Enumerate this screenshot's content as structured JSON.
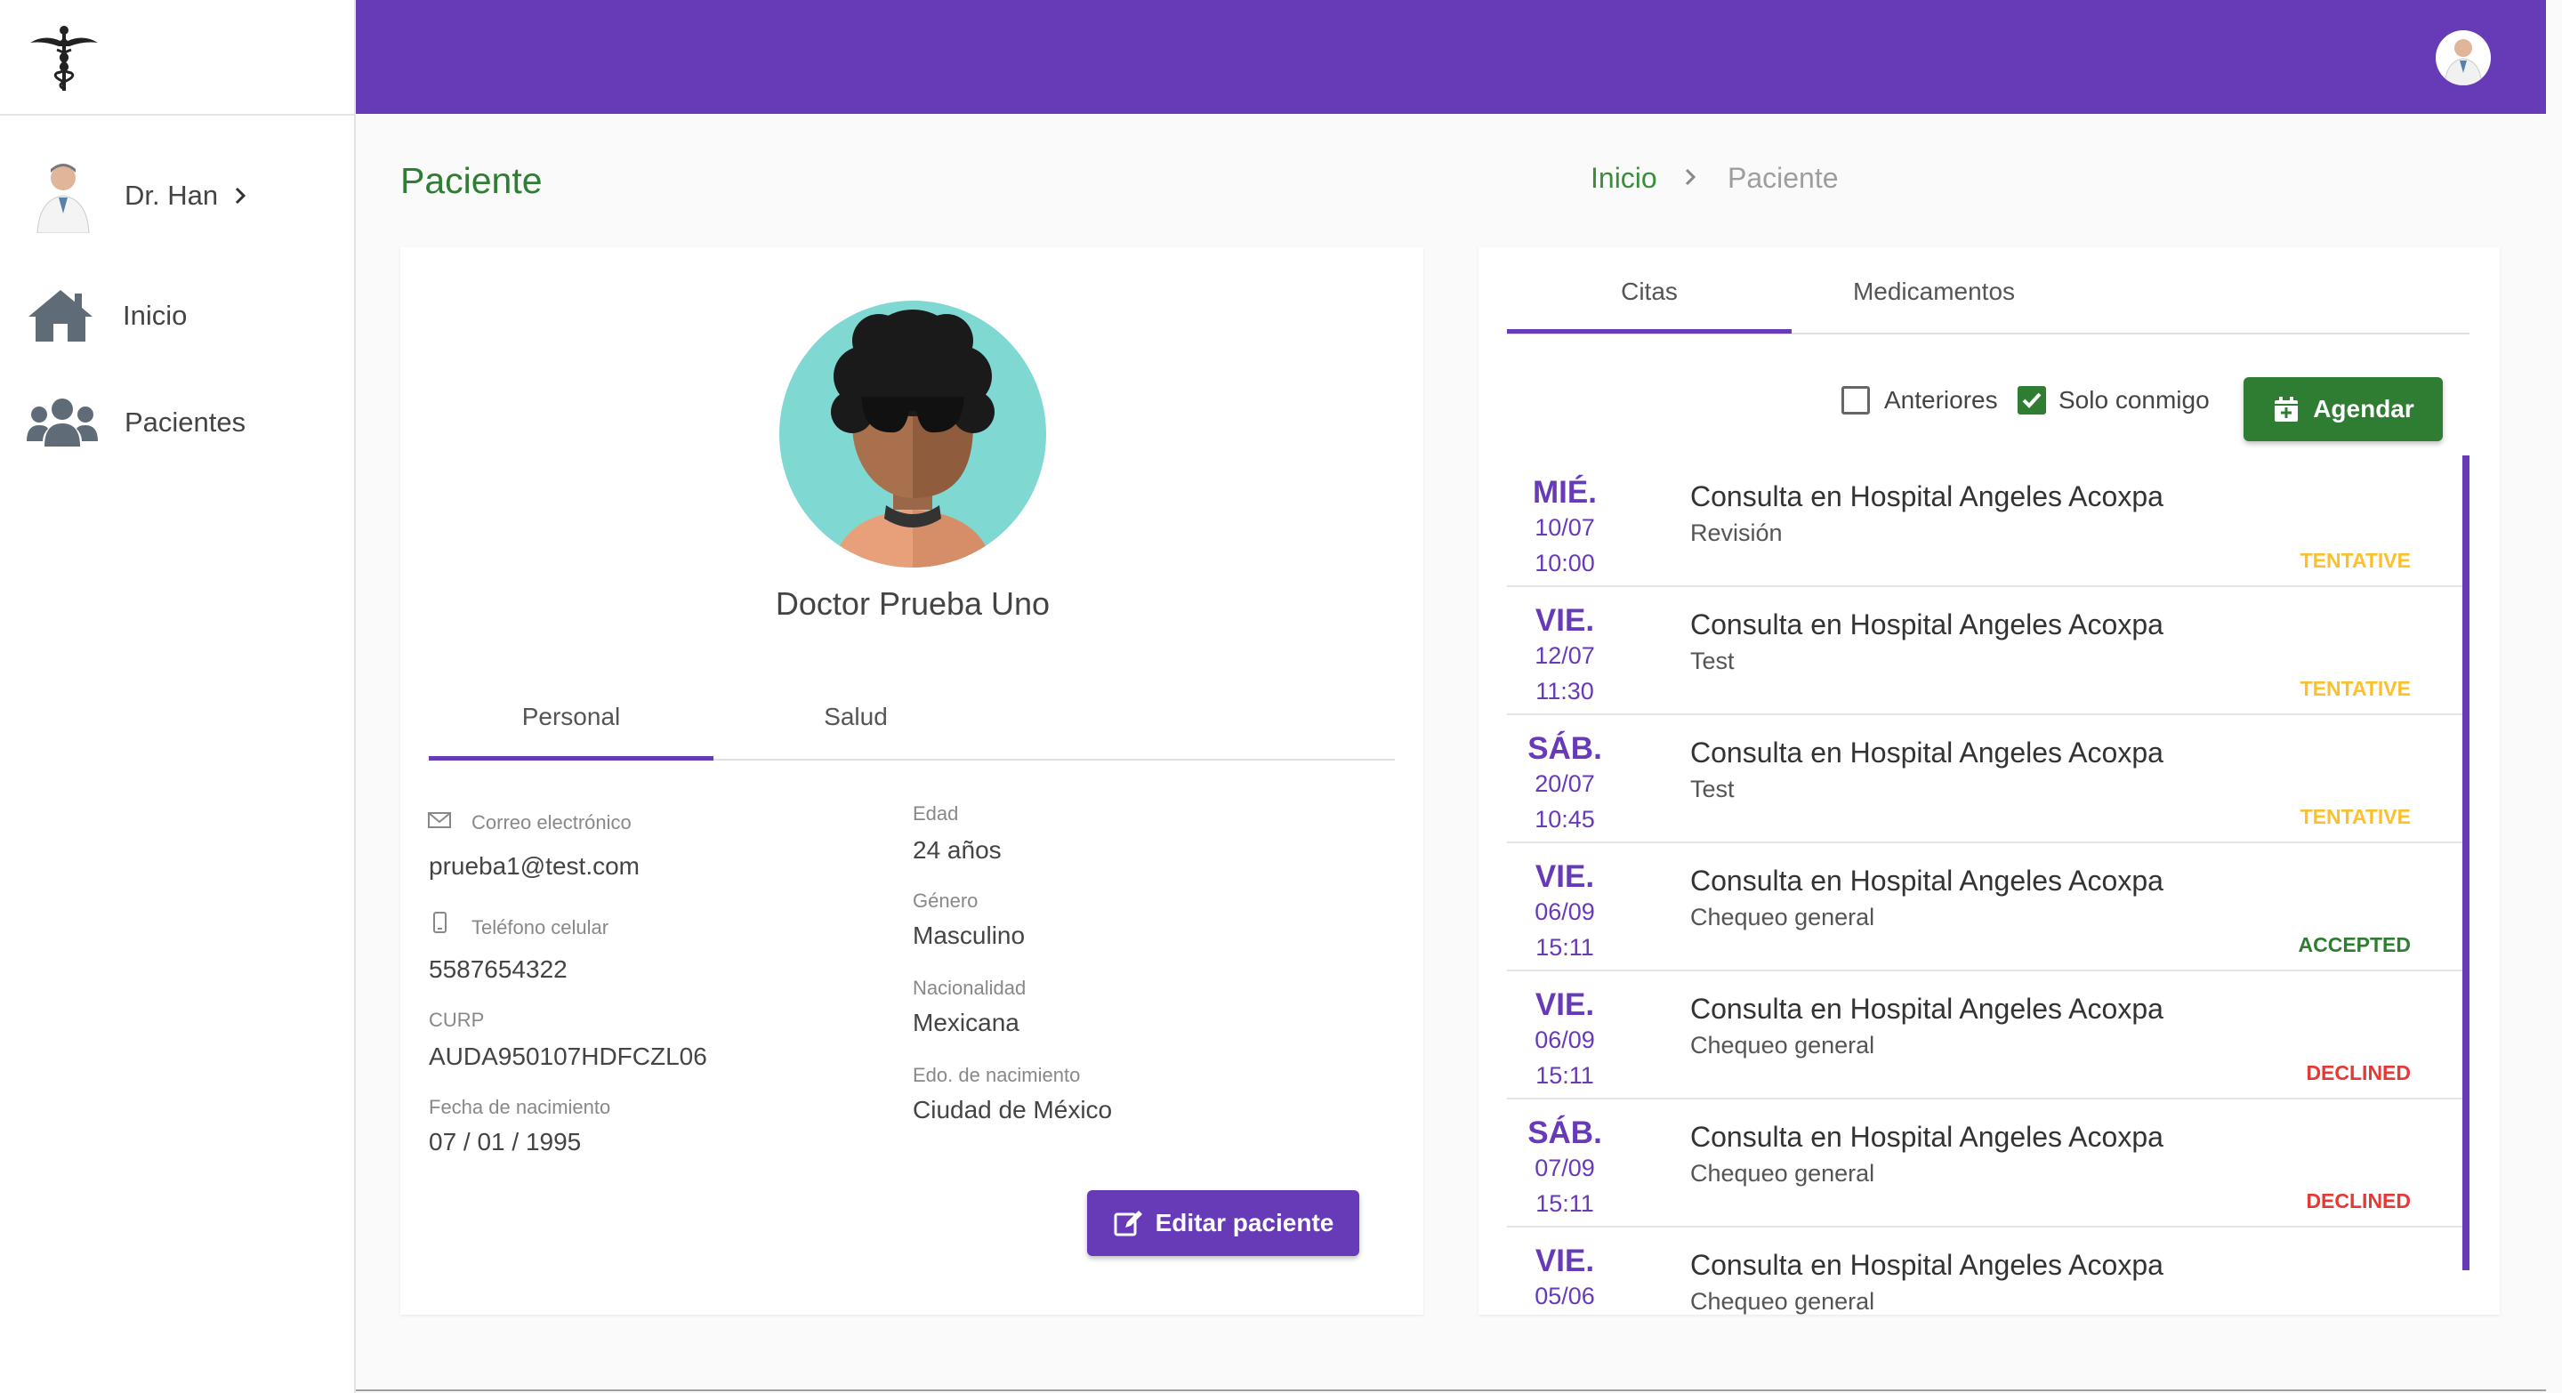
{
  "sidebar": {
    "logo_icon": "caduceus-icon",
    "user": {
      "name": "Dr. Han"
    },
    "items": [
      {
        "label": "Inicio",
        "icon": "home-icon"
      },
      {
        "label": "Pacientes",
        "icon": "users-icon"
      }
    ]
  },
  "header": {
    "accent": "#673ab7"
  },
  "page": {
    "title": "Paciente"
  },
  "breadcrumb": {
    "home": "Inicio",
    "current": "Paciente"
  },
  "patient": {
    "name": "Doctor Prueba Uno",
    "tabs": [
      "Personal",
      "Salud"
    ],
    "active_tab": "Personal",
    "fields": {
      "email_label": "Correo electrónico",
      "email": "prueba1@test.com",
      "phone_label": "Teléfono celular",
      "phone": "5587654322",
      "curp_label": "CURP",
      "curp": "AUDA950107HDFCZL06",
      "birth_label": "Fecha de nacimiento",
      "birth": "07 / 01 / 1995",
      "age_label": "Edad",
      "age": "24 años",
      "gender_label": "Género",
      "gender": "Masculino",
      "nationality_label": "Nacionalidad",
      "nationality": "Mexicana",
      "birth_state_label": "Edo. de nacimiento",
      "birth_state": "Ciudad de México"
    },
    "edit_button": "Editar paciente"
  },
  "appointments": {
    "tabs": [
      "Citas",
      "Medicamentos"
    ],
    "active_tab": "Citas",
    "filter_previous": {
      "label": "Anteriores",
      "checked": false
    },
    "filter_mine": {
      "label": "Solo conmigo",
      "checked": true
    },
    "schedule_button": "Agendar",
    "status_colors": {
      "TENTATIVE": "#fbc02d",
      "ACCEPTED": "#2e7d32",
      "DECLINED": "#e53935"
    },
    "items": [
      {
        "day": "MIÉ.",
        "date": "10/07",
        "time": "10:00",
        "title": "Consulta en Hospital Angeles Acoxpa",
        "subtitle": "Revisión",
        "status": "TENTATIVE"
      },
      {
        "day": "VIE.",
        "date": "12/07",
        "time": "11:30",
        "title": "Consulta en Hospital Angeles Acoxpa",
        "subtitle": "Test",
        "status": "TENTATIVE"
      },
      {
        "day": "SÁB.",
        "date": "20/07",
        "time": "10:45",
        "title": "Consulta en Hospital Angeles Acoxpa",
        "subtitle": "Test",
        "status": "TENTATIVE"
      },
      {
        "day": "VIE.",
        "date": "06/09",
        "time": "15:11",
        "title": "Consulta en Hospital Angeles Acoxpa",
        "subtitle": "Chequeo general",
        "status": "ACCEPTED"
      },
      {
        "day": "VIE.",
        "date": "06/09",
        "time": "15:11",
        "title": "Consulta en Hospital Angeles Acoxpa",
        "subtitle": "Chequeo general",
        "status": "DECLINED"
      },
      {
        "day": "SÁB.",
        "date": "07/09",
        "time": "15:11",
        "title": "Consulta en Hospital Angeles Acoxpa",
        "subtitle": "Chequeo general",
        "status": "DECLINED"
      },
      {
        "day": "VIE.",
        "date": "05/06",
        "time": "",
        "title": "Consulta en Hospital Angeles Acoxpa",
        "subtitle": "Chequeo general",
        "status": ""
      }
    ]
  }
}
